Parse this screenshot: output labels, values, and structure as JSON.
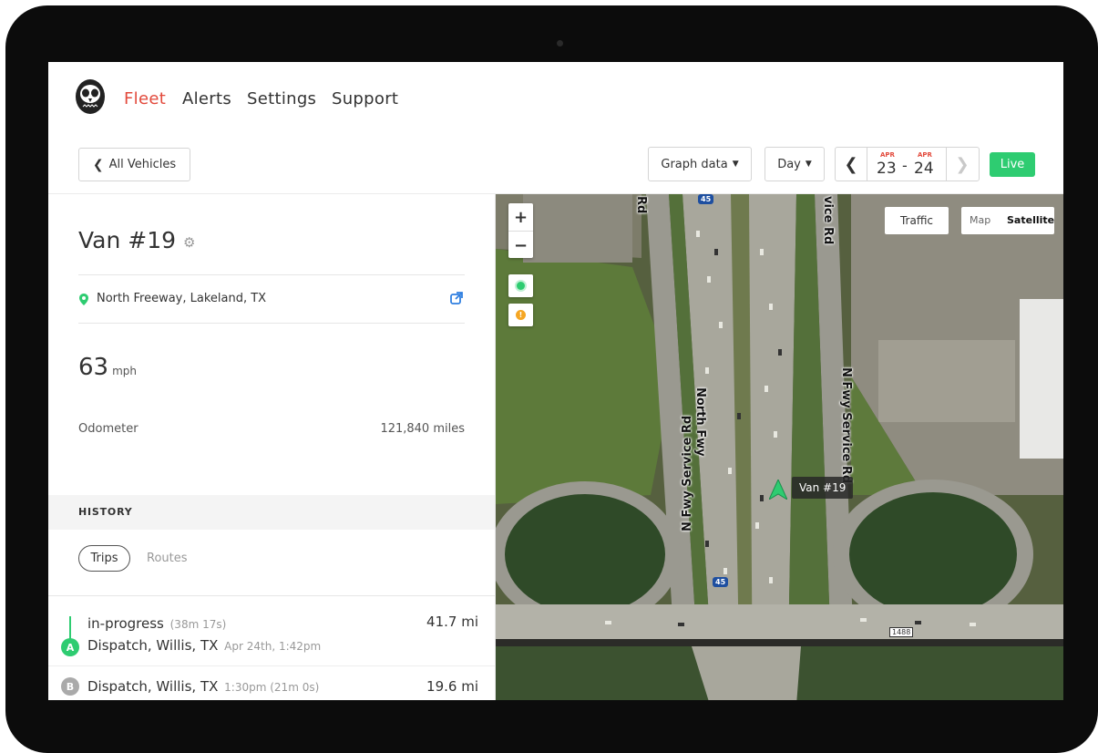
{
  "nav": {
    "items": [
      "Fleet",
      "Alerts",
      "Settings",
      "Support"
    ],
    "active": "Fleet"
  },
  "toolbar": {
    "back_label": "All Vehicles",
    "graph_label": "Graph data",
    "period_label": "Day",
    "date_from": {
      "month": "APR",
      "day": "23"
    },
    "date_to": {
      "month": "APR",
      "day": "24"
    },
    "separator": "-",
    "live_label": "Live"
  },
  "vehicle": {
    "name": "Van #19",
    "location": "North Freeway, Lakeland, TX",
    "speed": "63",
    "speed_unit": "mph",
    "odometer_label": "Odometer",
    "odometer_value": "121,840 miles"
  },
  "history": {
    "header": "HISTORY",
    "tabs": [
      "Trips",
      "Routes"
    ],
    "trips": [
      {
        "status": "in-progress",
        "duration": "(38m 17s)",
        "distance": "41.7 mi",
        "marker": "A",
        "location": "Dispatch, Willis, TX",
        "time": "Apr 24th, 1:42pm"
      },
      {
        "marker": "B",
        "location": "Dispatch, Willis, TX",
        "time": "1:30pm (21m 0s)",
        "distance": "19.6 mi"
      }
    ]
  },
  "map": {
    "zoom_in": "+",
    "zoom_out": "−",
    "traffic_label": "Traffic",
    "map_label": "Map",
    "satellite_label": "Satellite",
    "vehicle_label": "Van #19",
    "road_labels": [
      "North Fwy",
      "N Fwy Service Rd",
      "N Fwy Service Rd",
      "Rd",
      "vice Rd"
    ],
    "highway_shields": [
      "45",
      "45"
    ],
    "exit_number": "1488"
  },
  "colors": {
    "accent": "#e2493b",
    "live": "#2ecc71",
    "marker_active": "#2ecc71",
    "marker_past": "#aaaaaa"
  }
}
